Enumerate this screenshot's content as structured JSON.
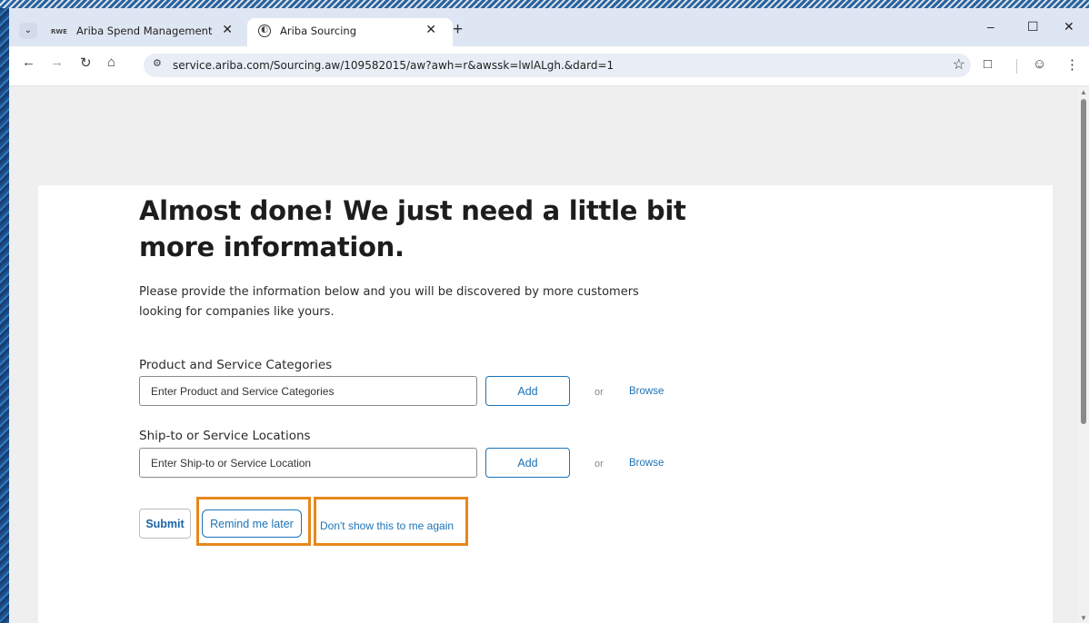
{
  "browser": {
    "tabs": [
      {
        "favicon": "RWE",
        "title": "Ariba Spend Management"
      },
      {
        "favicon": "globe-icon",
        "title": "Ariba Sourcing"
      }
    ],
    "url": "service.ariba.com/Sourcing.aw/109582015/aw?awh=r&awssk=lwlALgh.&dard=1"
  },
  "page": {
    "heading": "Almost done! We just need a little bit more information.",
    "intro": "Please provide the information below and you will be discovered by more customers looking for companies like yours.",
    "categories": {
      "label": "Product and Service Categories",
      "placeholder": "Enter Product and Service Categories",
      "add": "Add",
      "or": "or",
      "browse": "Browse"
    },
    "locations": {
      "label": "Ship-to or Service Locations",
      "placeholder": "Enter Ship-to or Service Location",
      "add": "Add",
      "or": "or",
      "browse": "Browse"
    },
    "actions": {
      "submit": "Submit",
      "remind": "Remind me later",
      "dont_show": "Don't show this to me again"
    }
  },
  "colors": {
    "link": "#1b73b8",
    "highlight": "#e8871a",
    "tabstrip": "#dfe6f3"
  }
}
